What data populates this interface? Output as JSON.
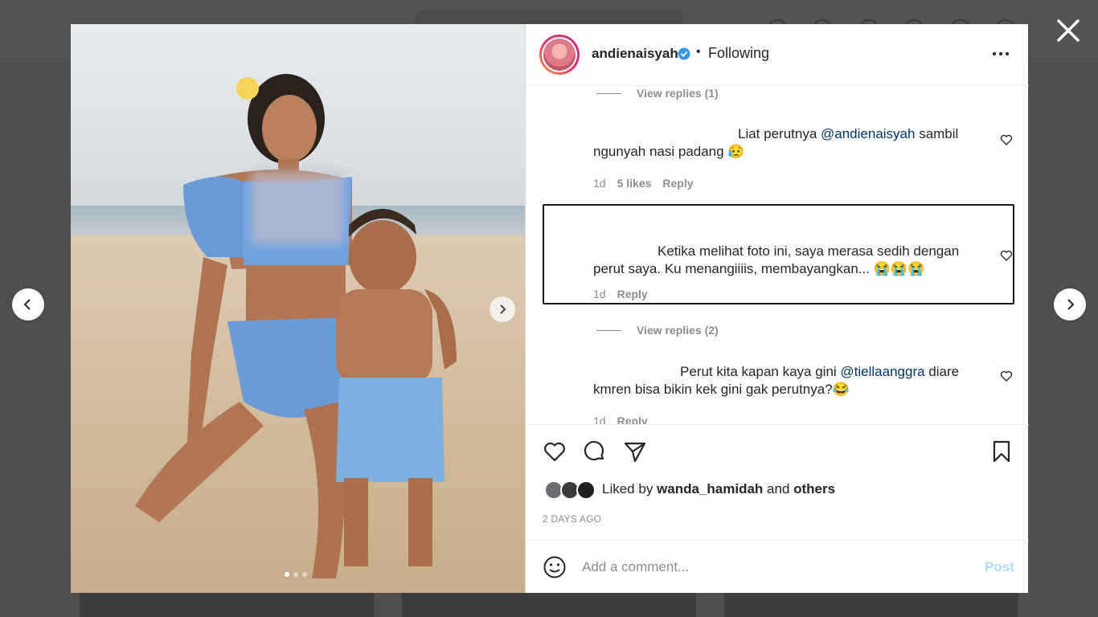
{
  "post": {
    "username": "andienaisyah",
    "separator": "•",
    "follow_state": "Following"
  },
  "comments": [
    {
      "view_replies": "View replies (1)"
    },
    {
      "text_before": "Liat perutnya ",
      "mention": "@andienaisyah",
      "text_after": " sambil ngunyah nasi padang 😥",
      "time": "1d",
      "likes": "5 likes",
      "reply": "Reply"
    },
    {
      "text": "Ketika melihat foto ini, saya merasa sedih dengan perut saya. Ku menangiiiis, membayangkan... 😭😭😭",
      "time": "1d",
      "reply": "Reply"
    },
    {
      "view_replies": "View replies (2)"
    },
    {
      "text_before": "Perut kita kapan kaya gini ",
      "mention": "@tiellaanggra",
      "text_after": " diare kmren bisa bikin kek gini gak perutnya?😂",
      "time": "1d",
      "reply": "Reply"
    }
  ],
  "liked": {
    "prefix": "Liked by ",
    "user": "wanda_hamidah",
    "middle": " and ",
    "others": "others"
  },
  "date": "2 DAYS AGO",
  "add_comment": {
    "placeholder": "Add a comment...",
    "post_label": "Post"
  },
  "colors": {
    "mention": "#00376b",
    "post_disabled": "#b3dbff",
    "verified": "#3897f0"
  }
}
